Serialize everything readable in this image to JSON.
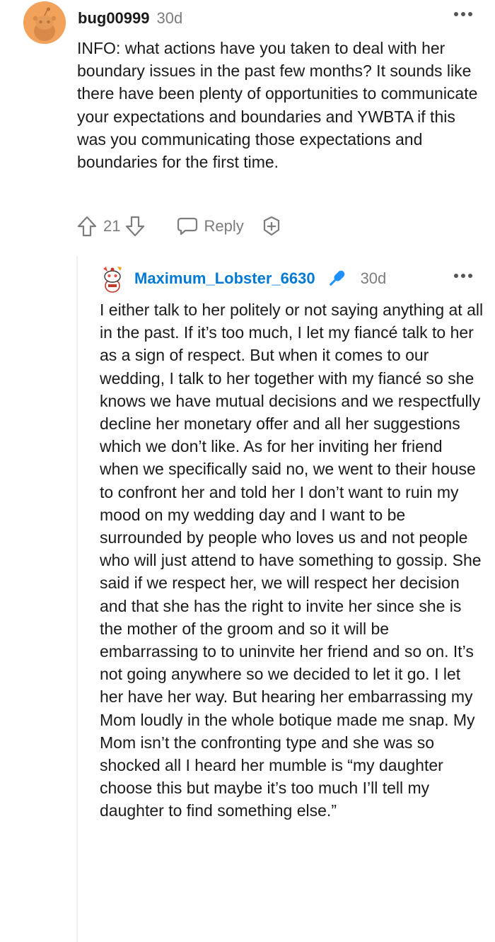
{
  "comment": {
    "username": "bug00999",
    "age": "30d",
    "body": "INFO: what actions have you taken to deal with her boundary issues in the past few months? It sounds like there have been plenty of opportunities to communicate your expectations and boundaries and YWBTA if this was you communicating those expectations and boundaries for the first time.",
    "score": "21",
    "reply_label": "Reply",
    "avatar_color": "#f2a25a"
  },
  "reply": {
    "username": "Maximum_Lobster_6630",
    "age": "30d",
    "username_color": "#0079d3",
    "badge_icon": "microphone-icon",
    "body": "I either talk to her politely or not saying anything at all in the past. If it’s too much, I let my fiancé talk to her as a sign of respect. But when it comes to our wedding, I talk to her together with my fiancé so she knows we have mutual decisions and we respectfully decline her monetary offer and all her suggestions which we don’t like. As for her inviting her friend when we specifically said no, we went to their house to confront her and told her I don’t want to ruin my mood on my wedding day and I want to be surrounded by people who loves us and not people who will just attend to have something to gossip. She said if we respect her, we will respect her decision and that she has the right to invite her since she is the mother of the groom and so it will be embarrassing to to uninvite her friend and so on. It’s not going anywhere so we decided to let it go. I let her have her way. But hearing her embarrassing my Mom loudly in the whole botique made me snap. My Mom isn’t the confronting type and she was so shocked all I heard her mumble is “my daughter choose this but maybe it’s too much I’ll tell my daughter to find something else.”"
  }
}
